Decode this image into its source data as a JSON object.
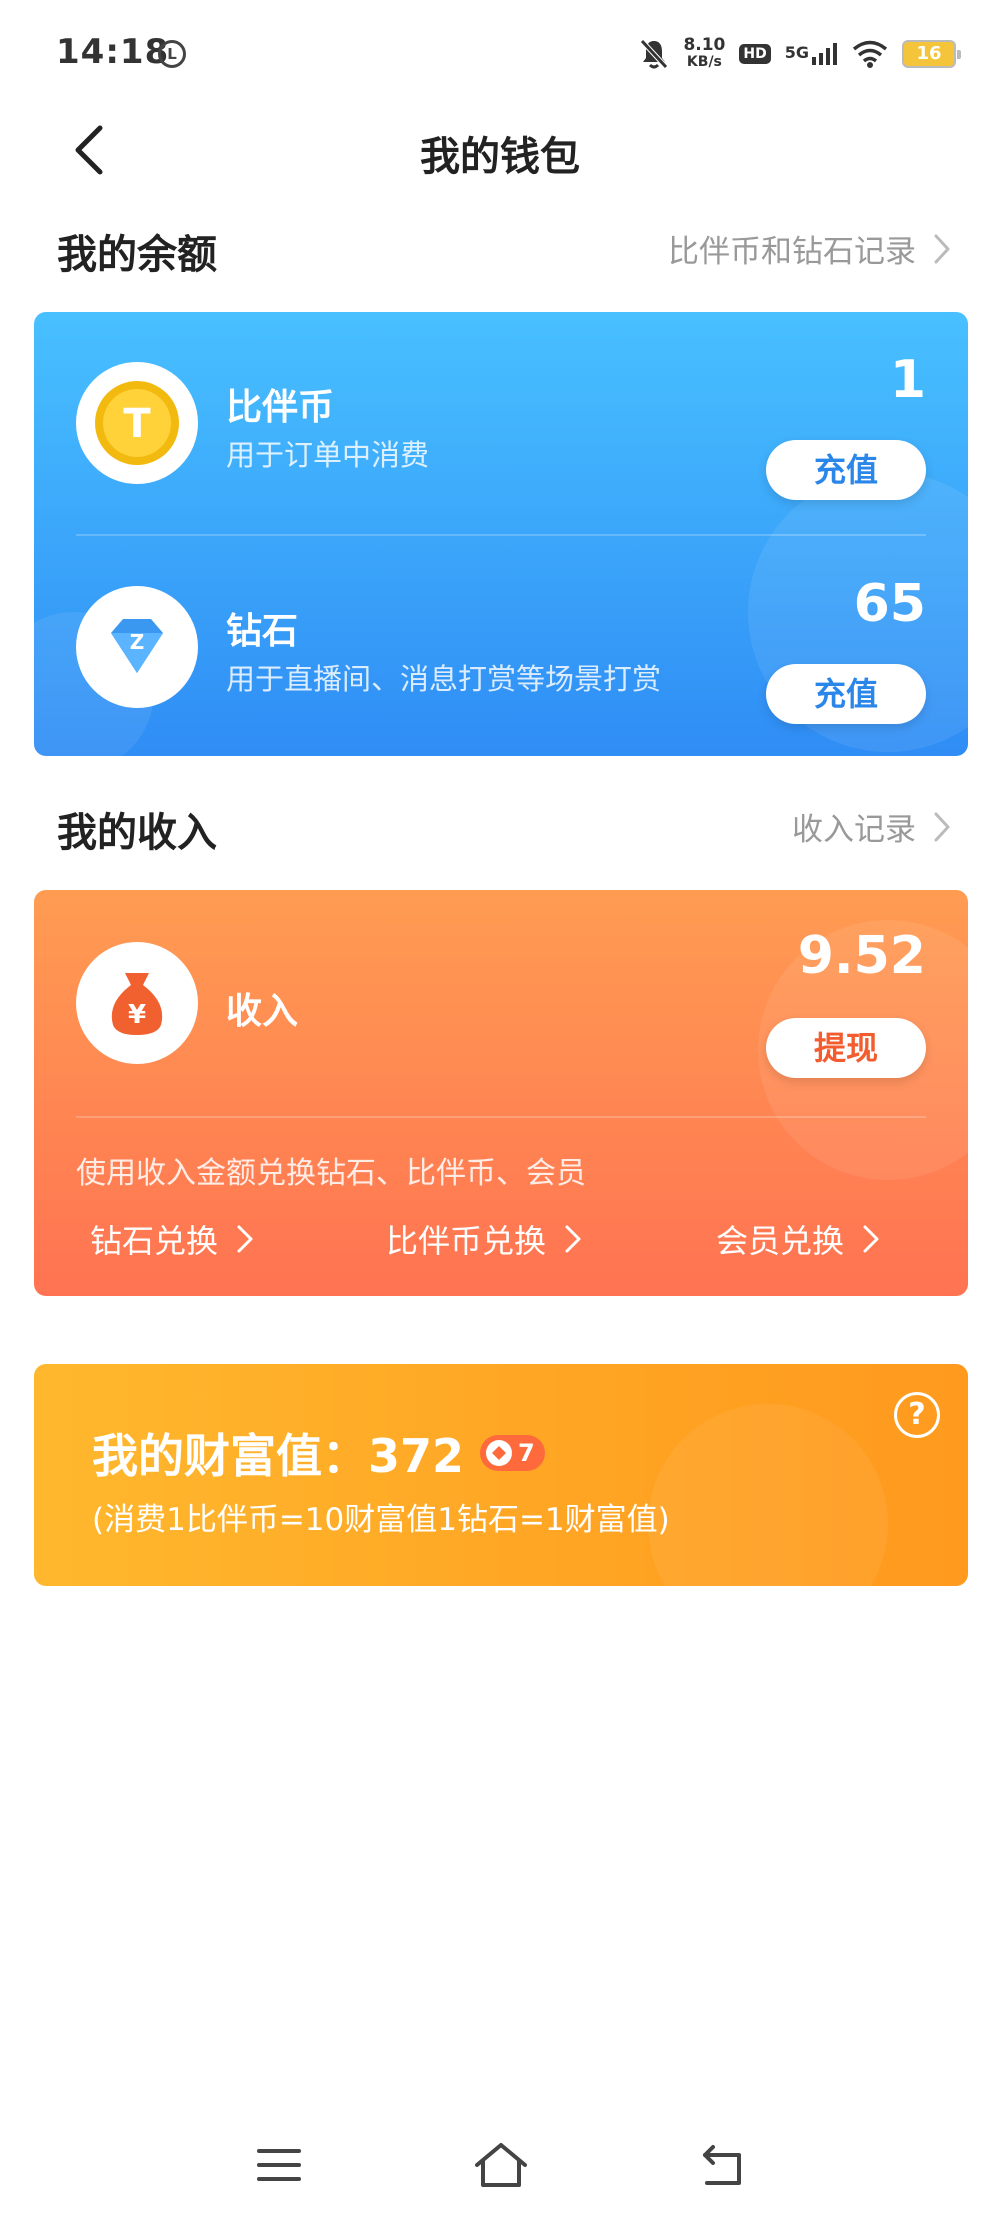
{
  "status_bar": {
    "time": "14:18",
    "circle_glyph": "L",
    "net_speed_value": "8.10",
    "net_speed_unit": "KB/s",
    "hd_label": "HD",
    "signal_label": "5G",
    "battery": "16"
  },
  "header": {
    "title": "我的钱包"
  },
  "balance_section": {
    "title": "我的余额",
    "link": "比伴币和钻石记录"
  },
  "balance_card": {
    "coin": {
      "name": "比伴币",
      "desc": "用于订单中消费",
      "value": "1",
      "button": "充值",
      "icon_letter": "T"
    },
    "diamond": {
      "name": "钻石",
      "desc": "用于直播间、消息打赏等场景打赏",
      "value": "65",
      "button": "充值",
      "icon_letter": "Z"
    }
  },
  "income_section": {
    "title": "我的收入",
    "link": "收入记录"
  },
  "income_card": {
    "name": "收入",
    "value": "9.52",
    "button": "提现",
    "icon_symbol": "¥",
    "tip": "使用收入金额兑换钻石、比伴币、会员",
    "exchanges": [
      "钻石兑换",
      "比伴币兑换",
      "会员兑换"
    ]
  },
  "wealth_card": {
    "title": "我的财富值：372",
    "badge_count": "7",
    "subtitle": "(消费1比伴币=10财富值1钻石=1财富值)",
    "help": "?"
  },
  "colors": {
    "blue_card_top": "#48c0ff",
    "blue_card_bottom": "#2f8df5",
    "orange_card_top": "#ff9c52",
    "orange_card_bottom": "#ff7352",
    "wealth_card": "#ffa423"
  }
}
